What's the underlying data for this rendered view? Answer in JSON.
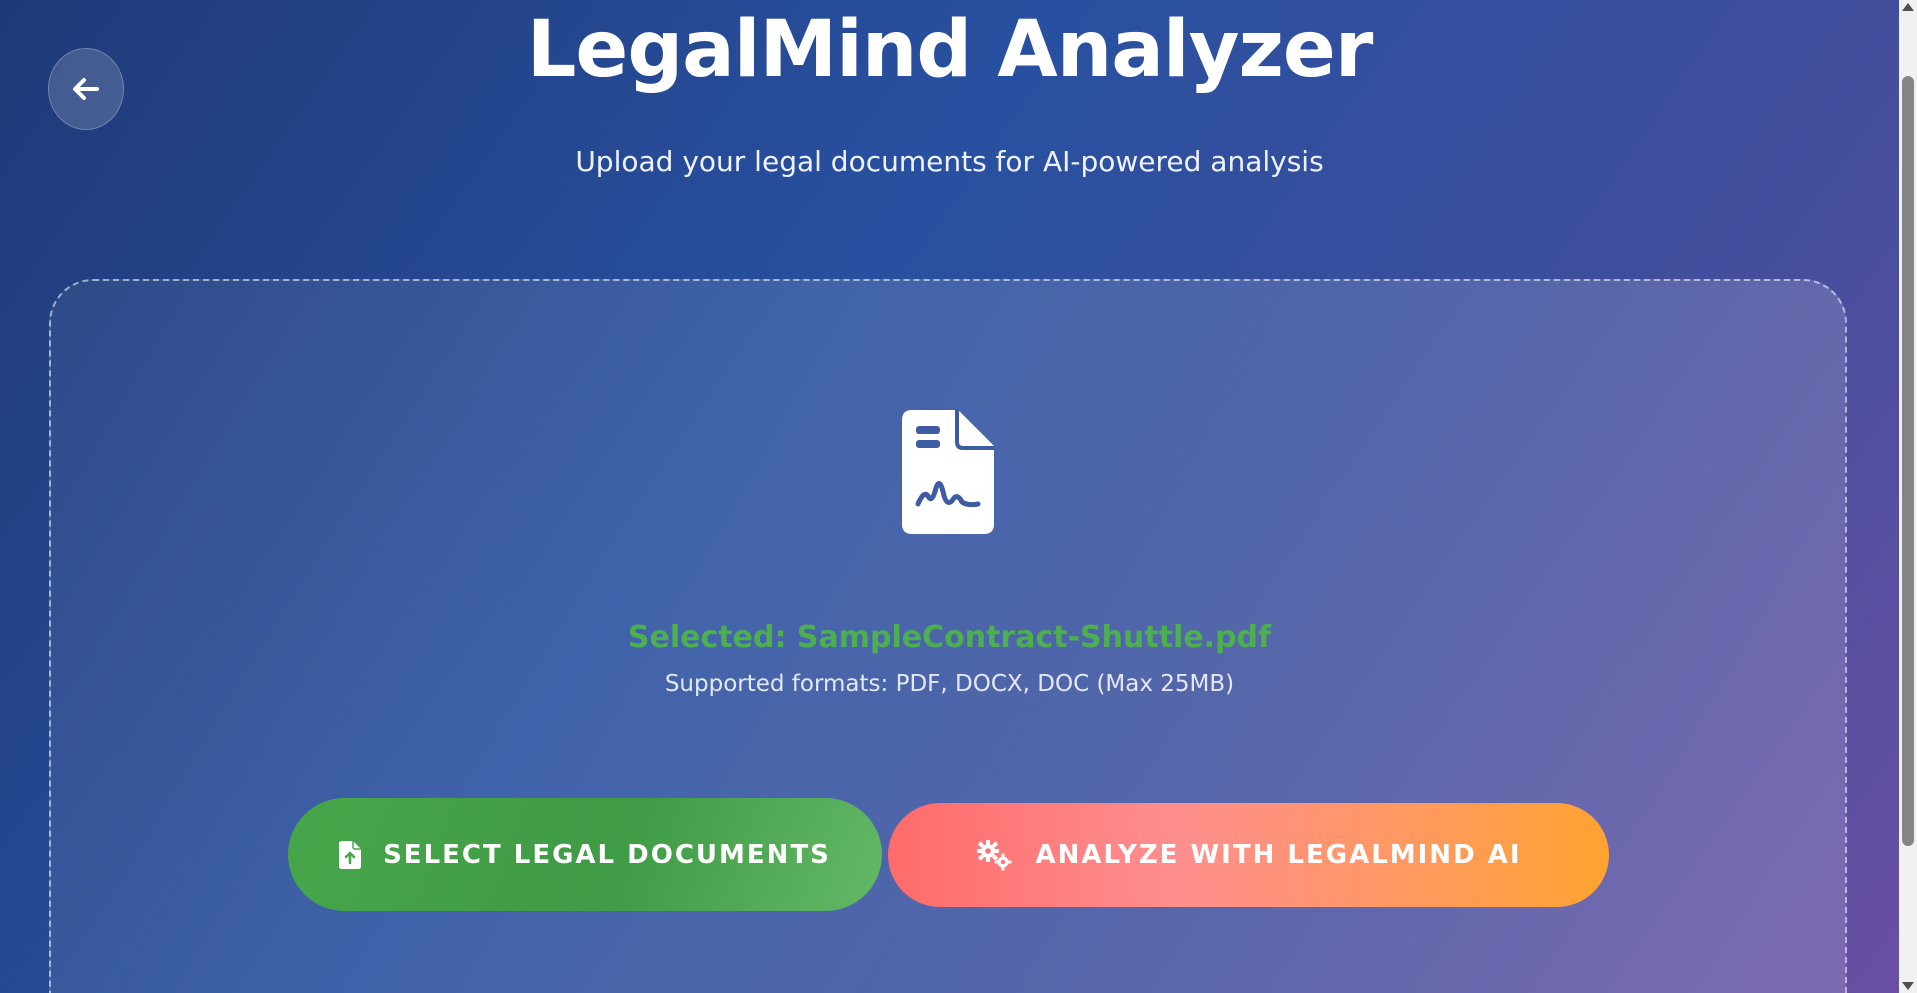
{
  "header": {
    "title": "LegalMind Analyzer",
    "subtitle": "Upload your legal documents for AI-powered analysis",
    "back_icon": "arrow-left-icon"
  },
  "upload": {
    "document_icon": "file-signature-icon",
    "selected_text": "Selected: SampleContract-Shuttle.pdf",
    "supported_formats": "Supported formats: PDF, DOCX, DOC (Max 25MB)"
  },
  "actions": {
    "select_label": "SELECT LEGAL DOCUMENTS",
    "select_icon": "file-upload-icon",
    "analyze_label": "ANALYZE WITH LEGALMIND AI",
    "analyze_icon": "gears-icon"
  },
  "colors": {
    "selected_text": "#4cb050",
    "select_button": "#47a64a",
    "analyze_button_start": "#ff6b6b",
    "analyze_button_end": "#ffa330"
  }
}
